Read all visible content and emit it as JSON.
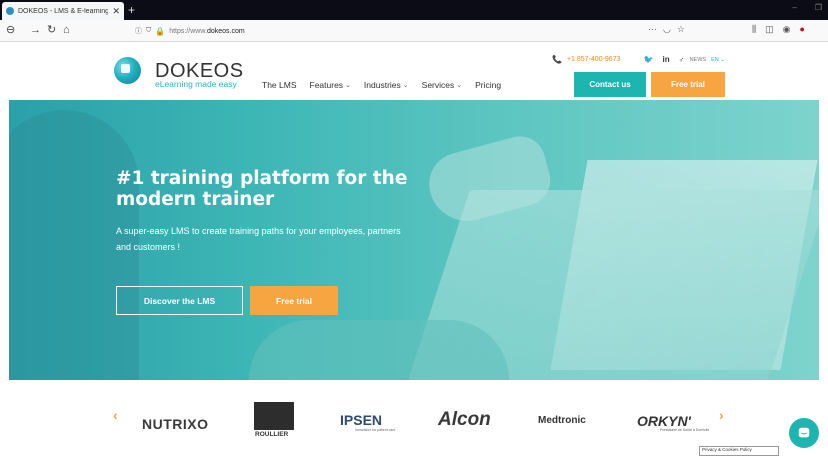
{
  "browser": {
    "tab_title": "DOKEOS - LMS & E-learning S...",
    "tab_close": "✕",
    "new_tab": "+",
    "url_prefix": "https://www.",
    "url_domain": "dokeos.com",
    "window_controls": [
      "–",
      "❐",
      "✕"
    ]
  },
  "header": {
    "logo_name": "DOKEOS",
    "logo_tagline": "eLearning made easy",
    "phone": "+1 857-400-9673",
    "social": [
      "🐦",
      "in",
      "♂"
    ],
    "news_label": "NEWS",
    "lang": "EN ⌄",
    "contact_label": "Contact us",
    "trial_label": "Free trial",
    "nav": [
      {
        "label": "The LMS",
        "has_dropdown": false
      },
      {
        "label": "Features",
        "has_dropdown": true
      },
      {
        "label": "Industries",
        "has_dropdown": true
      },
      {
        "label": "Services",
        "has_dropdown": true
      },
      {
        "label": "Pricing",
        "has_dropdown": false
      }
    ]
  },
  "hero": {
    "title": "#1 training platform for the modern trainer",
    "subtitle": "A super-easy LMS to create training paths for your employees, partners and customers !",
    "discover_label": "Discover the LMS",
    "trial_label": "Free trial"
  },
  "clients": {
    "prev": "‹",
    "next": "›",
    "logos": {
      "nutrixo": "NUTRIXO",
      "roullier": "ROULLIER",
      "ipsen": "IPSEN",
      "ipsen_tag": "Innovation for patient care",
      "alcon": "Alcon",
      "medtronic": "Medtronic",
      "orkyn": "ORKYN'",
      "orkyn_tag": "Prestataire de Santé à Domicile"
    }
  },
  "footer": {
    "privacy": "Privacy & Cookies Policy"
  },
  "colors": {
    "teal": "#1db5b0",
    "orange": "#f7a541",
    "hero_bg": "#3db6b6"
  }
}
